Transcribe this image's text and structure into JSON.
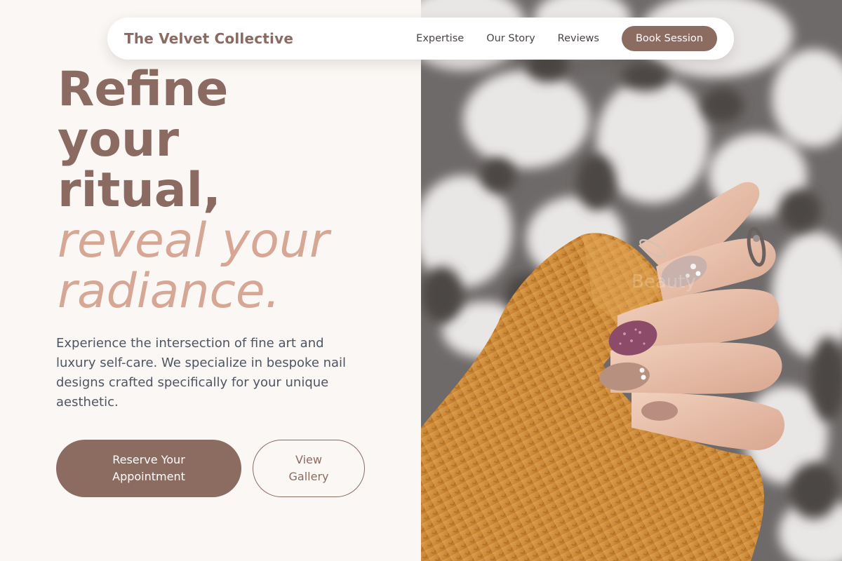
{
  "brand": {
    "name": "The Velvet Collective"
  },
  "nav": {
    "links": [
      "Expertise",
      "Our Story",
      "Reviews"
    ],
    "cta": "Book Session"
  },
  "hero": {
    "headline_lines": [
      "Refine",
      "your",
      "ritual,"
    ],
    "headline_accent_lines": [
      "reveal your",
      "radiance."
    ],
    "intro": "Experience the intersection of fine art and luxury self-care. We specialize in bespoke nail designs crafted specifically for your unique aesthetic.",
    "primary_button": "Reserve Your Appointment",
    "secondary_button": "View Gallery",
    "image_watermark": "Beauty"
  },
  "colors": {
    "brand": "#8b6b61",
    "accent": "#d6a795",
    "background": "#faf7f4",
    "body_text": "#4e5563",
    "button": "#8c6b61"
  }
}
